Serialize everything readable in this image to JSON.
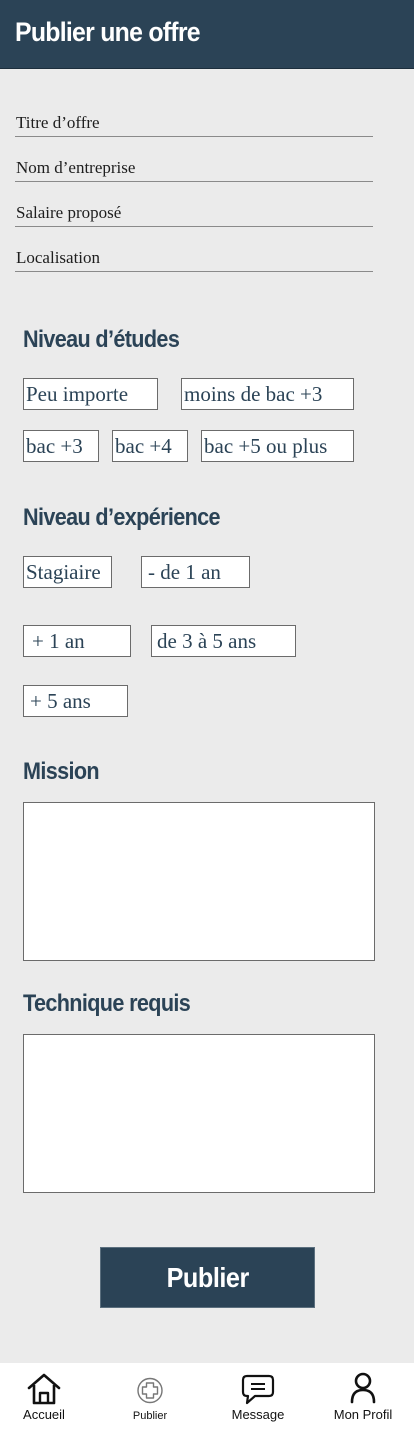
{
  "header": {
    "title": "Publier une offre"
  },
  "form": {
    "fields": [
      {
        "placeholder": "Titre d’offre"
      },
      {
        "placeholder": "Nom d’entreprise"
      },
      {
        "placeholder": "Salaire proposé"
      },
      {
        "placeholder": "Localisation"
      }
    ]
  },
  "education": {
    "title": "Niveau d’études",
    "options": [
      "Peu importe",
      "moins de bac +3",
      "bac +3",
      "bac +4",
      "bac +5 ou plus"
    ]
  },
  "experience": {
    "title": "Niveau d’expérience",
    "options": [
      "Stagiaire",
      "- de 1 an",
      " + 1 an",
      "de 3 à 5 ans",
      "+ 5 ans"
    ]
  },
  "mission": {
    "title": "Mission"
  },
  "technique": {
    "title": "Technique requis"
  },
  "actions": {
    "publish_label": "Publier"
  },
  "nav": {
    "items": [
      {
        "label": "Accueil",
        "icon": "home-icon"
      },
      {
        "label": "Publier",
        "icon": "plus-circle-icon"
      },
      {
        "label": "Message",
        "icon": "message-icon"
      },
      {
        "label": "Mon Profil",
        "icon": "user-icon"
      }
    ]
  },
  "colors": {
    "primary": "#2b4356",
    "background": "#ebebeb"
  }
}
